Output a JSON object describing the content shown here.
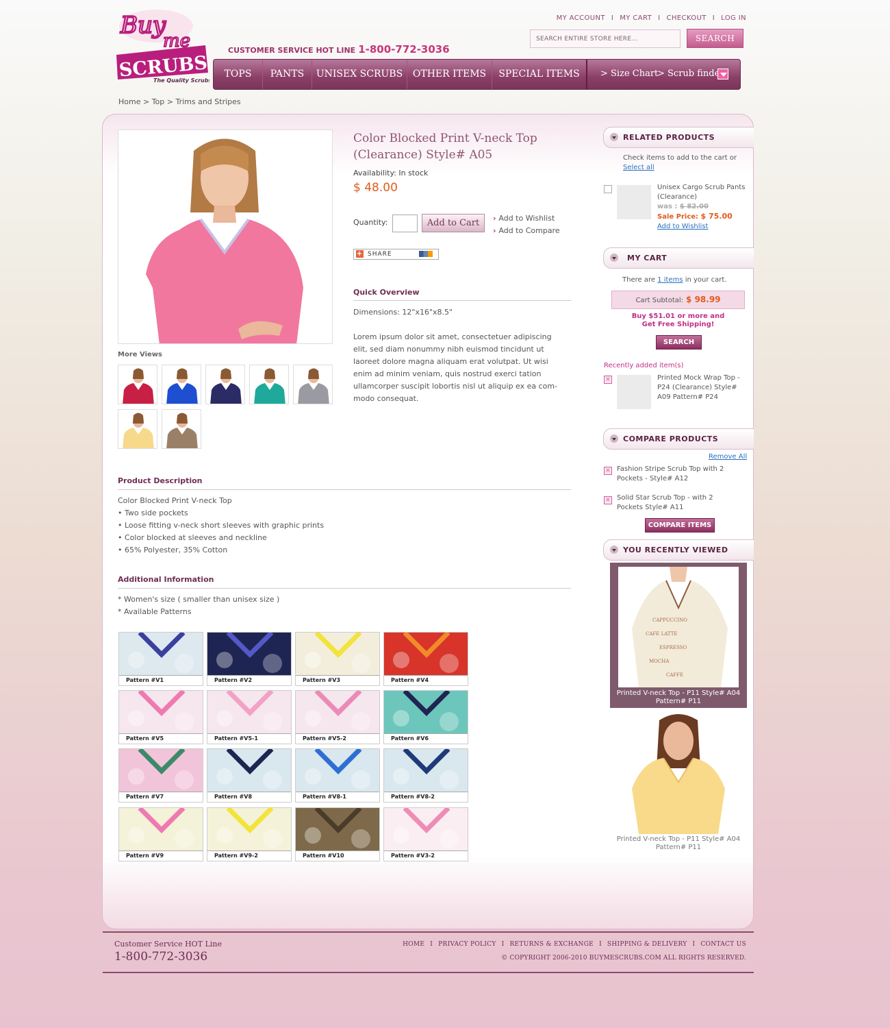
{
  "header": {
    "logo_line1": "Buy",
    "logo_line2": "me",
    "logo_line3": "SCRUBS",
    "logo_tagline": "The Quality Scrubs",
    "top_links": [
      "MY ACCOUNT",
      "MY CART",
      "CHECKOUT",
      "LOG IN"
    ],
    "search_placeholder": "SEARCH ENTIRE STORE HERE...",
    "search_button": "SEARCH",
    "hotline_label": "CUSTOMER SERVICE  HOT LINE",
    "hotline_number": "1-800-772-3036"
  },
  "nav": {
    "items": [
      "TOPS",
      "PANTS",
      "UNISEX SCRUBS",
      "OTHER ITEMS",
      "SPECIAL ITEMS"
    ],
    "size_chart": "> Size Chart",
    "scrub_finder": "> Scrub finder"
  },
  "breadcrumb": "Home > Top > Trims and Stripes",
  "product": {
    "title": "Color Blocked Print V-neck Top (Clearance) Style# A05",
    "availability": "Availability: In stock",
    "price": "$ 48.00",
    "quantity_label": "Quantity:",
    "add_to_cart": "Add to Cart",
    "add_to_wishlist": "Add to Wishlist",
    "add_to_compare": "Add to Compare",
    "share": "SHARE",
    "more_views_label": "More Views",
    "more_views_colors": [
      "#c81f44",
      "#1d4fd0",
      "#2b2b66",
      "#1fa99a",
      "#9a9aa2",
      "#f6d98a",
      "#9b8068"
    ],
    "quick_overview_title": "Quick Overview",
    "dimensions": "Dimensions: 12\"x16\"x8.5\"",
    "overview_text": "Lorem ipsum dolor sit amet, consectetuer adipiscing elit, sed diam nonummy nibh euismod tincidunt ut laoreet dolore magna aliquam erat volutpat. Ut wisi enim ad minim veniam, quis nostrud exerci tation ullamcorper suscipit lobortis nisl ut aliquip ex ea com-modo consequat.",
    "description_title": "Product Description",
    "description_lines": [
      "Color Blocked Print V-neck Top",
      "• Two side pockets",
      "• Loose fitting v-neck short sleeves with graphic prints",
      "• Color blocked at sleeves and neckline",
      "• 65% Polyester, 35% Cotton"
    ],
    "additional_title": "Additional Information",
    "additional_lines": [
      "* Women's size ( smaller than unisex size )",
      "* Available Patterns"
    ]
  },
  "patterns": [
    {
      "label": "Pattern #V1",
      "bg": "#dde9ef",
      "trim": "#3a3fa0"
    },
    {
      "label": "Pattern #V2",
      "bg": "#1f2552",
      "trim": "#5558c8"
    },
    {
      "label": "Pattern #V3",
      "bg": "#f3eedc",
      "trim": "#f3e33a"
    },
    {
      "label": "Pattern #V4",
      "bg": "#d8342a",
      "trim": "#f08a2a"
    },
    {
      "label": "Pattern #V5",
      "bg": "#f6e6ee",
      "trim": "#ef79b0"
    },
    {
      "label": "Pattern #V5-1",
      "bg": "#f6e6ee",
      "trim": "#f3a1c6"
    },
    {
      "label": "Pattern #V5-2",
      "bg": "#f6e6ee",
      "trim": "#eb8bb5"
    },
    {
      "label": "Pattern #V6",
      "bg": "#6cc6bb",
      "trim": "#1f2552"
    },
    {
      "label": "Pattern #V7",
      "bg": "#f2c4d9",
      "trim": "#3b8a6a"
    },
    {
      "label": "Pattern #V8",
      "bg": "#d9e7ef",
      "trim": "#1f2552"
    },
    {
      "label": "Pattern #V8-1",
      "bg": "#d9e7ef",
      "trim": "#2d6fd3"
    },
    {
      "label": "Pattern #V8-2",
      "bg": "#d9e7ef",
      "trim": "#1f3a7a"
    },
    {
      "label": "Pattern #V9",
      "bg": "#f4f2d8",
      "trim": "#ef79b0"
    },
    {
      "label": "Pattern #V9-2",
      "bg": "#f4f2d8",
      "trim": "#f2e43a"
    },
    {
      "label": "Pattern #V10",
      "bg": "#7e6a4a",
      "trim": "#4a3b2a"
    },
    {
      "label": "Pattern #V3-2",
      "bg": "#fbeef3",
      "trim": "#ef8cb6"
    }
  ],
  "sidebar": {
    "related_title": "RELATED PRODUCTS",
    "related_intro": "Check items to add to the cart or",
    "select_all": "Select all",
    "related_item_name": "Unisex Cargo Scrub Pants (Clearance)",
    "related_item_was_label": "was :",
    "related_item_was": "$ 82.00",
    "related_item_sale_label": "Sale Price:",
    "related_item_sale": "$ 75.00",
    "related_item_wishlist": "Add to Wishlist",
    "cart_title": "MY CART",
    "cart_text_pre": "There are",
    "cart_items_link": "1 items",
    "cart_text_post": "in your cart.",
    "cart_subtotal_label": "Cart Subtotal:",
    "cart_subtotal": "$ 98.99",
    "free_ship_line1": "Buy $51.01 or more and",
    "free_ship_line2": "Get Free Shipping!",
    "cart_button": "SEARCH",
    "recent_label": "Recently added item(s)",
    "recent_item": "Printed Mock Wrap Top - P24 (Clearance) Style# A09 Pattern# P24",
    "compare_title": "COMPARE PRODUCTS",
    "remove_all": "Remove All",
    "compare_items": [
      "Fashion Stripe Scrub Top with 2 Pockets - Style# A12",
      "Solid Star Scrub Top - with 2 Pockets Style# A11"
    ],
    "compare_button": "COMPARE ITEMS",
    "viewed_title": "YOU RECENTLY VIEWED",
    "viewed_items": [
      "Printed V-neck Top - P11 Style# A04 Pattern# P11",
      "Printed V-neck Top - P11 Style# A04 Pattern# P11"
    ]
  },
  "footer": {
    "service": "Customer Service  HOT Line",
    "phone": "1-800-772-3036",
    "links": [
      "HOME",
      "PRIVACY POLICY",
      "RETURNS & EXCHANGE",
      "SHIPPING & DELIVERY",
      "CONTACT US"
    ],
    "copyright": "© COPYRIGHT 2006-2010 BUYMESCRUBS.COM ALL RIGHTS RESERVED."
  }
}
